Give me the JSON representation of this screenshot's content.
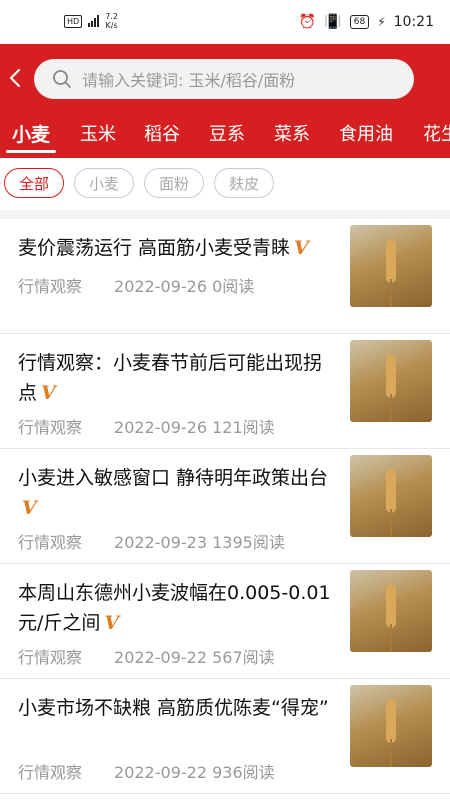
{
  "status": {
    "speed_value": "7.2",
    "speed_unit": "K/s",
    "battery": "68",
    "time": "10:21"
  },
  "search": {
    "placeholder": "请输入关键词: 玉米/稻谷/面粉"
  },
  "tabs": [
    "小麦",
    "玉米",
    "稻谷",
    "豆系",
    "菜系",
    "食用油",
    "花生"
  ],
  "active_tab": 0,
  "chips": [
    "全部",
    "小麦",
    "面粉",
    "麸皮"
  ],
  "active_chip": 0,
  "colors": {
    "brand_red": "#d61f21",
    "vip_orange": "#e07b22"
  },
  "articles": [
    {
      "title": "麦价震荡运行 高面筋小麦受青睐",
      "vip": "V",
      "category": "行情观察",
      "date": "2022-09-26",
      "reads": "0阅读",
      "thumb": "wheat-image"
    },
    {
      "title": "行情观察：小麦春节前后可能出现拐点",
      "vip": "V",
      "category": "行情观察",
      "date": "2022-09-26",
      "reads": "121阅读",
      "thumb": "wheat-image"
    },
    {
      "title": "小麦进入敏感窗口 静待明年政策出台",
      "vip": "V",
      "category": "行情观察",
      "date": "2022-09-23",
      "reads": "1395阅读",
      "thumb": "wheat-image"
    },
    {
      "title": "本周山东德州小麦波幅在0.005-0.01元/斤之间",
      "vip": "V",
      "category": "行情观察",
      "date": "2022-09-22",
      "reads": "567阅读",
      "thumb": "wheat-image"
    },
    {
      "title": "小麦市场不缺粮 高筋质优陈麦“得宠”",
      "vip": "",
      "category": "行情观察",
      "date": "2022-09-22",
      "reads": "936阅读",
      "thumb": "wheat-image"
    }
  ]
}
